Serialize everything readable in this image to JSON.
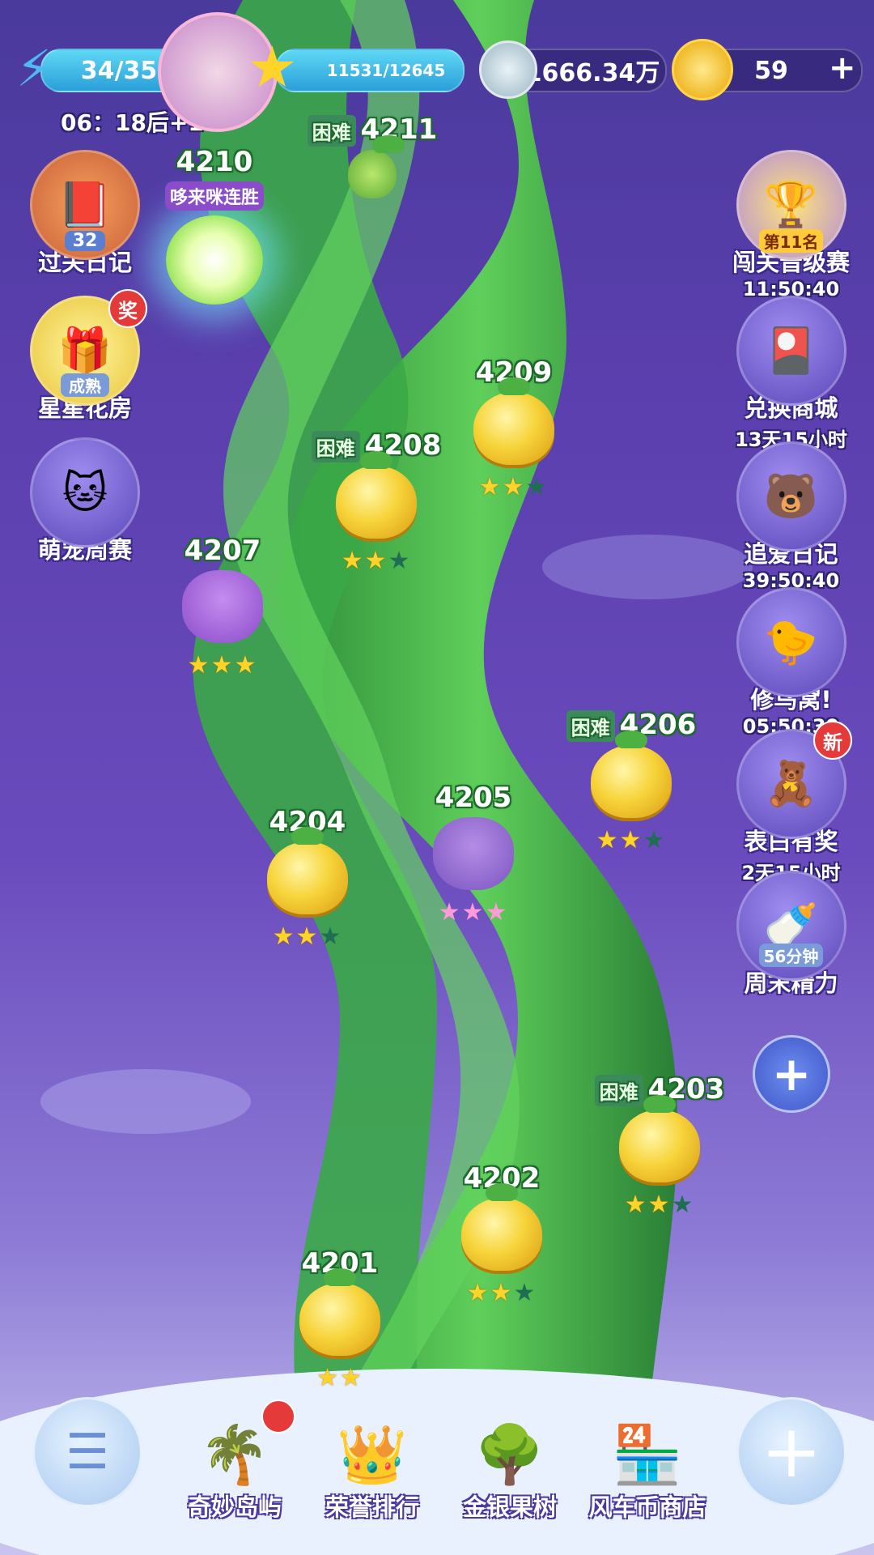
{
  "topbar": {
    "energy": "34/35",
    "energy_timer": "06：18后+1",
    "star_progress": "11531/12645",
    "silver_coins": "1666.34万",
    "gold_coins": "59",
    "plus": "+"
  },
  "current_level": {
    "number": "4210",
    "mode_label": "哆来咪连胜"
  },
  "levels": [
    {
      "number": "4211",
      "hard": "困难",
      "stars": 0
    },
    {
      "number": "4209",
      "hard": "",
      "stars": 2
    },
    {
      "number": "4208",
      "hard": "困难",
      "stars": 2
    },
    {
      "number": "4207",
      "hard": "",
      "stars": 3
    },
    {
      "number": "4206",
      "hard": "困难",
      "stars": 2
    },
    {
      "number": "4205",
      "hard": "",
      "stars": 3
    },
    {
      "number": "4204",
      "hard": "",
      "stars": 2
    },
    {
      "number": "4203",
      "hard": "困难",
      "stars": 2
    },
    {
      "number": "4202",
      "hard": "",
      "stars": 2
    },
    {
      "number": "4201",
      "hard": "",
      "stars": 2
    }
  ],
  "left_buttons": [
    {
      "label": "过关日记",
      "count": "32"
    },
    {
      "label": "星星花房",
      "status": "成熟",
      "badge": "奖"
    },
    {
      "label": "萌宠周赛"
    }
  ],
  "right_buttons": [
    {
      "label": "闯关晋级赛",
      "rank": "第11名",
      "timer": "11:50:40"
    },
    {
      "label": "兑换商城",
      "timer": "13天15小时"
    },
    {
      "label": "追爱日记",
      "timer": "39:50:40"
    },
    {
      "label": "修鸟窝!",
      "timer": "05:50:39"
    },
    {
      "label": "表白有奖",
      "timer": "2天15小时",
      "badge": "新"
    },
    {
      "label": "周末精力",
      "duration": "56分钟"
    }
  ],
  "bottom_nav": [
    {
      "label": "奇妙岛屿"
    },
    {
      "label": "荣誉排行",
      "rank": "1"
    },
    {
      "label": "金银果树"
    },
    {
      "label": "风车币商店"
    }
  ],
  "colors": {
    "bg_top": "#4a3a9c",
    "stalk": "#3fae45",
    "star_on": "#ffd42a",
    "badge": "#e43a3a"
  }
}
